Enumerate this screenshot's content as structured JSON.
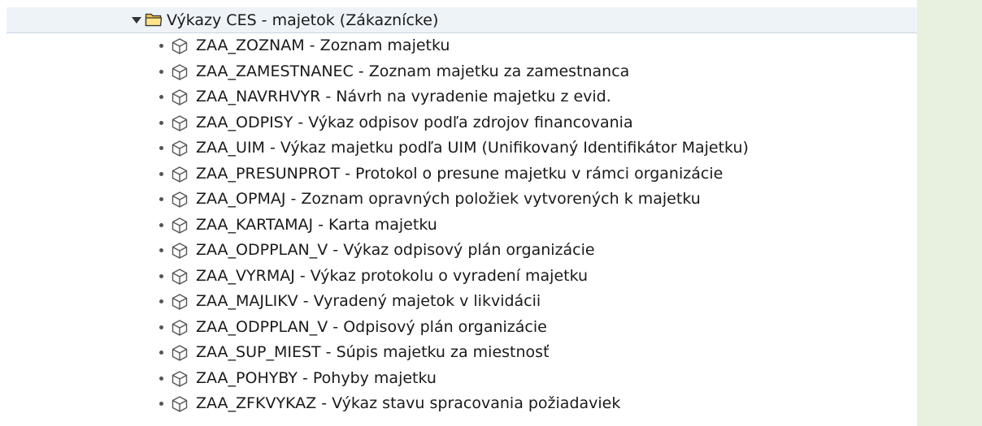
{
  "folder": {
    "label": "Výkazy CES - majetok (Zákaznícke)",
    "expanded": true,
    "icon": "folder-open-icon"
  },
  "items": [
    {
      "label": "ZAA_ZOZNAM - Zoznam majetku",
      "icon": "cube-icon"
    },
    {
      "label": "ZAA_ZAMESTNANEC - Zoznam majetku za zamestnanca",
      "icon": "cube-icon"
    },
    {
      "label": "ZAA_NAVRHVYR - Návrh na vyradenie majetku z evid.",
      "icon": "cube-icon"
    },
    {
      "label": "ZAA_ODPISY - Výkaz odpisov podľa zdrojov financovania",
      "icon": "cube-icon"
    },
    {
      "label": "ZAA_UIM - Výkaz majetku podľa UIM (Unifikovaný Identifikátor Majetku)",
      "icon": "cube-icon"
    },
    {
      "label": "ZAA_PRESUNPROT - Protokol o presune majetku v rámci organizácie",
      "icon": "cube-icon"
    },
    {
      "label": "ZAA_OPMAJ - Zoznam opravných položiek vytvorených k majetku",
      "icon": "cube-icon"
    },
    {
      "label": "ZAA_KARTAMAJ - Karta majetku",
      "icon": "cube-icon"
    },
    {
      "label": "ZAA_ODPPLAN_V - Výkaz odpisový plán organizácie",
      "icon": "cube-icon"
    },
    {
      "label": "ZAA_VYRMAJ - Výkaz protokolu o vyradení majetku",
      "icon": "cube-icon"
    },
    {
      "label": "ZAA_MAJLIKV - Vyradený majetok v likvidácii",
      "icon": "cube-icon"
    },
    {
      "label": "ZAA_ODPPLAN_V - Odpisový plán organizácie",
      "icon": "cube-icon"
    },
    {
      "label": "ZAA_SUP_MIEST - Súpis majetku za miestnosť",
      "icon": "cube-icon"
    },
    {
      "label": "ZAA_POHYBY - Pohyby majetku",
      "icon": "cube-icon"
    },
    {
      "label": "ZAA_ZFKVYKAZ - Výkaz stavu spracovania požiadaviek",
      "icon": "cube-icon"
    }
  ],
  "colors": {
    "folder_row_bg": "#eef3f8",
    "right_pane_bg": "#e8f0e0",
    "text": "#1a1a1a",
    "icon_stroke": "#555555",
    "folder_fill": "#f3c64a"
  }
}
